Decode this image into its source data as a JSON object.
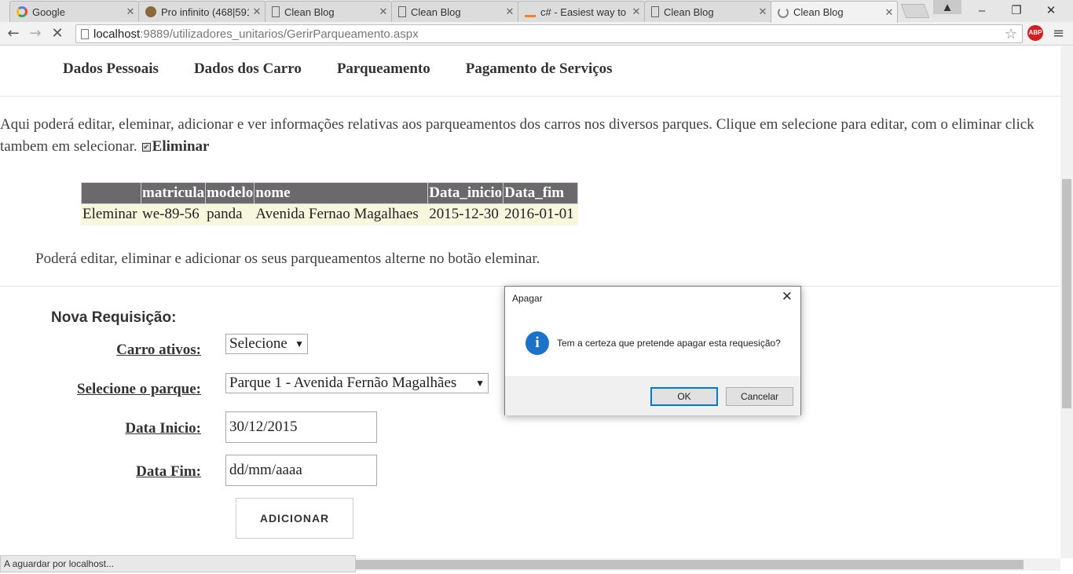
{
  "browser": {
    "tabs": [
      {
        "label": "Google",
        "icon": "google-icon"
      },
      {
        "label": "Pro infinito (468|591",
        "icon": "favicon-icon"
      },
      {
        "label": "Clean Blog",
        "icon": "page-icon"
      },
      {
        "label": "Clean Blog",
        "icon": "page-icon"
      },
      {
        "label": "c# - Easiest way to c",
        "icon": "stackoverflow-icon"
      },
      {
        "label": "Clean Blog",
        "icon": "page-icon"
      },
      {
        "label": "Clean Blog",
        "icon": "loading-icon"
      }
    ],
    "url_host": "localhost",
    "url_path": ":9889/utilizadores_unitarios/GerirParqueamento.aspx",
    "abp_label": "ABP",
    "status": "A aguardar por localhost..."
  },
  "nav": {
    "items": [
      "Dados Pessoais",
      "Dados dos Carro",
      "Parqueamento",
      "Pagamento de Serviços"
    ]
  },
  "intro": {
    "text": "Aqui poderá editar, eleminar, adicionar e ver informações relativas aos parqueamentos dos carros nos diversos parques. Clique em selecione para editar, com o eliminar click tambem em selecionar.",
    "checkbox_label": "Eliminar"
  },
  "table": {
    "headers": [
      "",
      "matricula",
      "modelo",
      "nome",
      "Data_inicio",
      "Data_fim"
    ],
    "rows": [
      [
        "Eleminar",
        "we-89-56",
        "panda",
        "Avenida Fernao Magalhaes",
        "2015-12-30",
        "2016-01-01"
      ]
    ]
  },
  "hint": "Poderá editar, eliminar e adicionar os seus parqueamentos alterne no botão eleminar.",
  "form": {
    "title": "Nova Requisição:",
    "car_label": "Carro ativos:",
    "car_value": "Selecione",
    "park_label": "Selecione o parque:",
    "park_value": "Parque 1 - Avenida Fernão Magalhães",
    "start_label": "Data Inicio:",
    "start_value": "30/12/2015",
    "end_label": "Data Fim:",
    "end_value": "dd/mm/aaaa",
    "submit": "ADICIONAR"
  },
  "dialog": {
    "title": "Apagar",
    "message": "Tem a certeza que pretende apagar esta requesição?",
    "ok": "OK",
    "cancel": "Cancelar",
    "icon_glyph": "i"
  }
}
